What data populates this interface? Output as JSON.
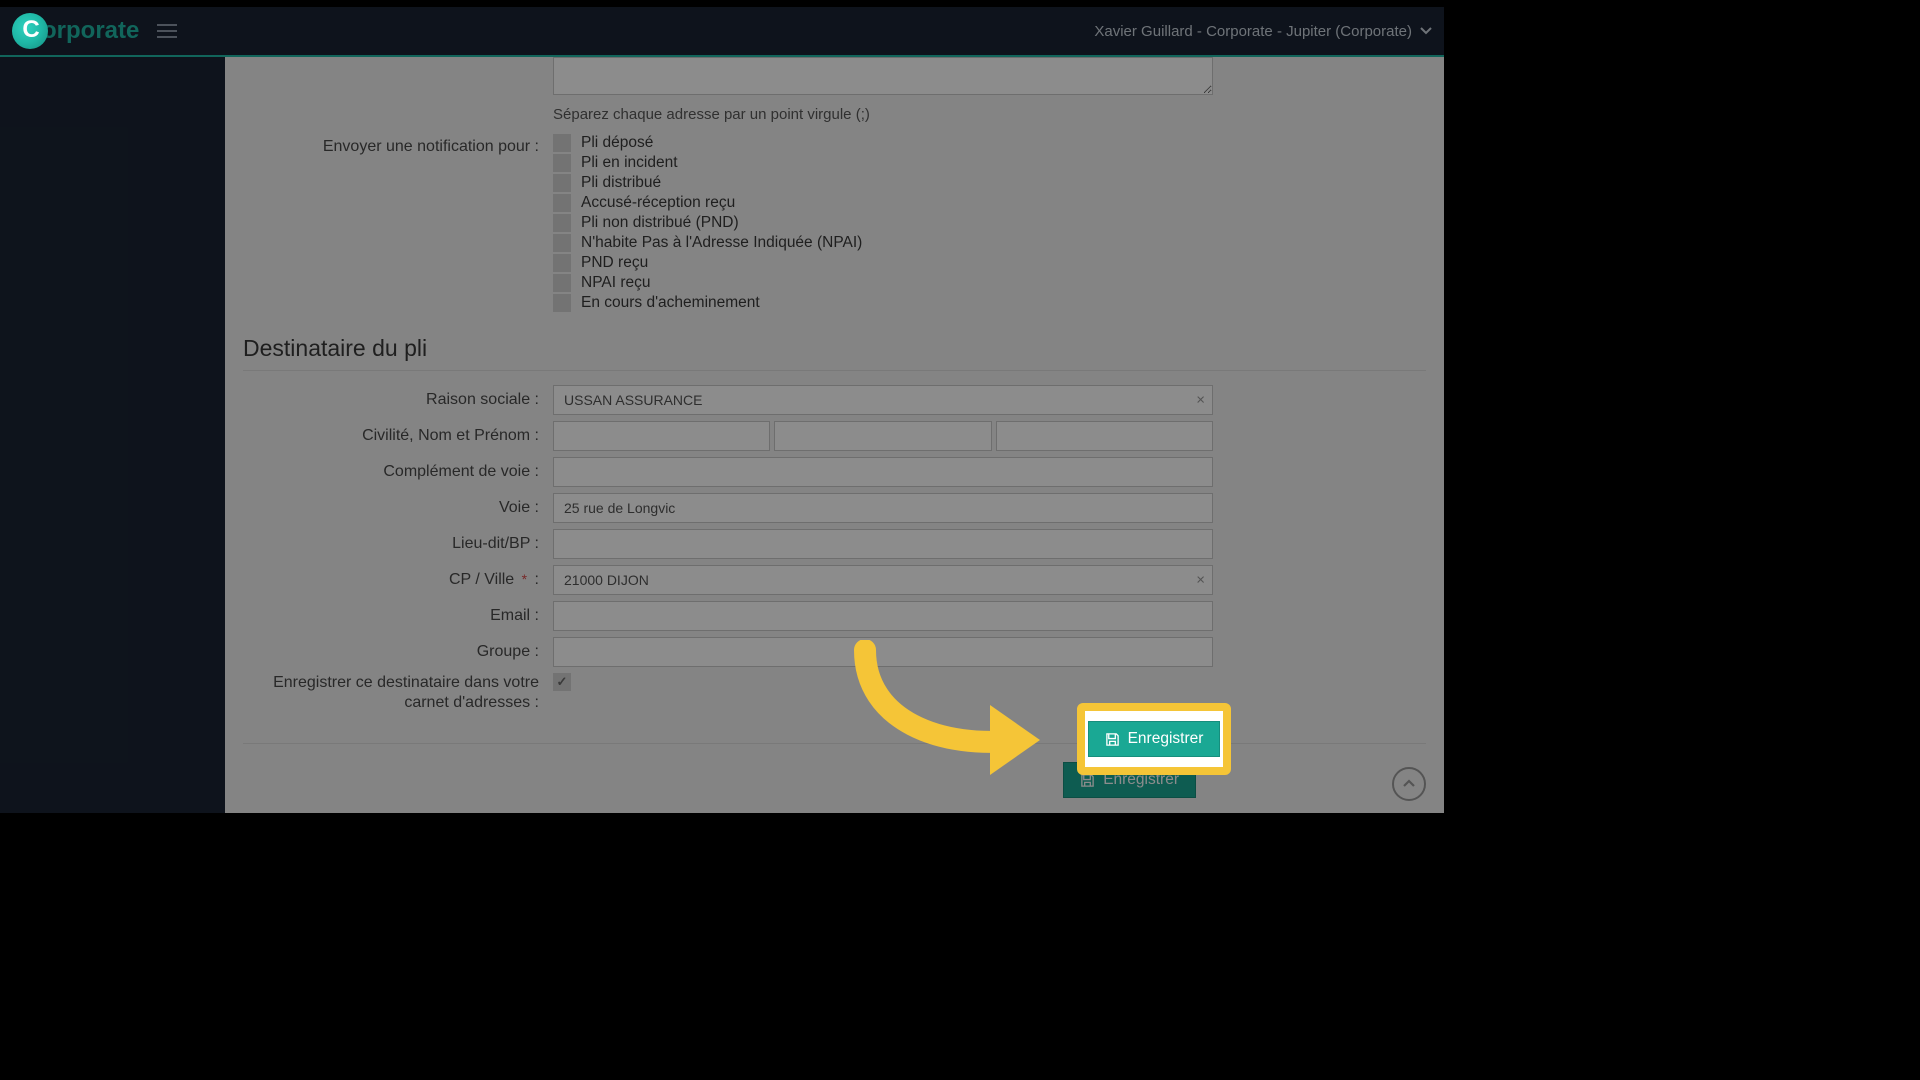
{
  "header": {
    "brand": "orporate",
    "user": "Xavier Guillard - Corporate - Jupiter (Corporate)"
  },
  "notification_block": {
    "hint": "Séparez chaque adresse par un point virgule (;)",
    "label": "Envoyer une notification pour :",
    "options": [
      "Pli déposé",
      "Pli en incident",
      "Pli distribué",
      "Accusé-réception reçu",
      "Pli non distribué (PND)",
      "N'habite Pas à l'Adresse Indiquée (NPAI)",
      "PND reçu",
      "NPAI reçu",
      "En cours d'acheminement"
    ]
  },
  "recipient": {
    "title": "Destinataire du pli",
    "labels": {
      "raison": "Raison sociale :",
      "civilite": "Civilité, Nom et Prénom :",
      "complement": "Complément de voie :",
      "voie": "Voie :",
      "lieudit": "Lieu-dit/BP :",
      "cpville": "CP / Ville",
      "email": "Email :",
      "groupe": "Groupe :",
      "save_contact": "Enregistrer ce destinataire dans votre carnet d'adresses :"
    },
    "values": {
      "raison": "USSAN ASSURANCE",
      "civilite": "",
      "nom": "",
      "prenom": "",
      "complement": "",
      "voie": "25 rue de Longvic",
      "lieudit": "",
      "cpville": "21000 DIJON",
      "email": "",
      "groupe": ""
    }
  },
  "actions": {
    "save": "Enregistrer"
  }
}
